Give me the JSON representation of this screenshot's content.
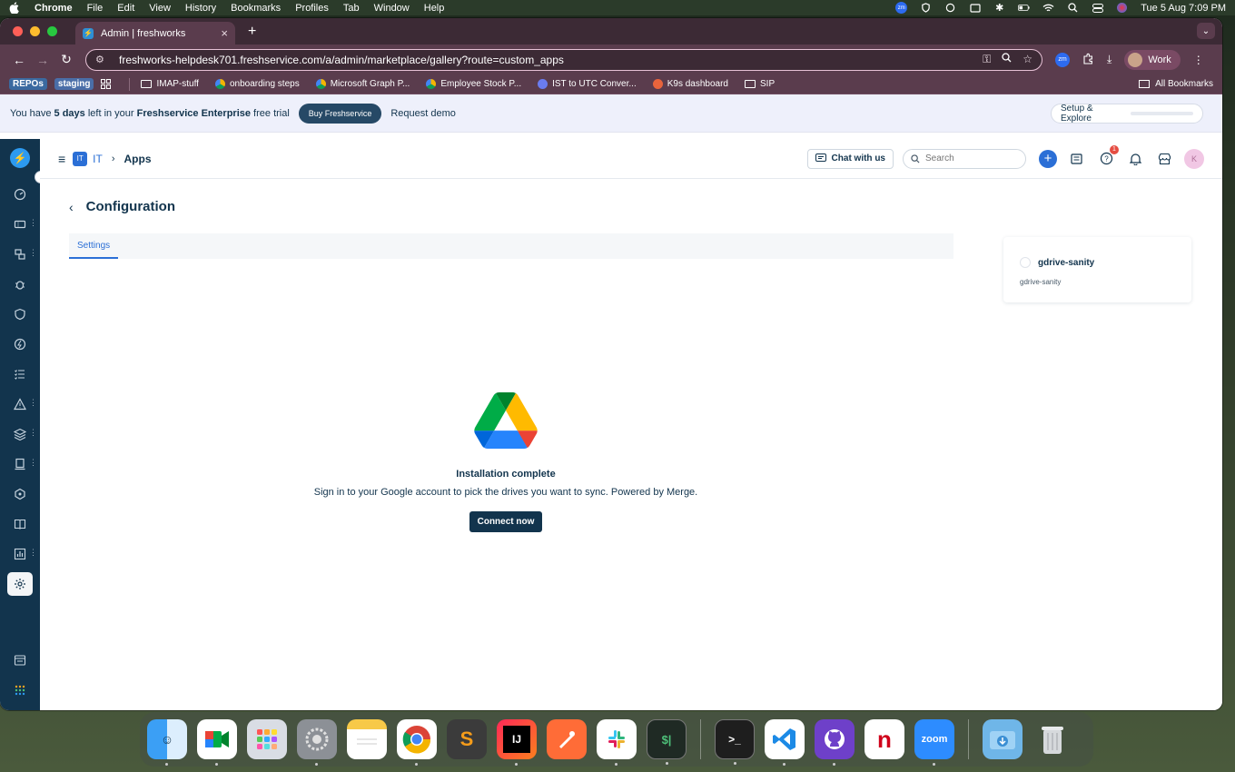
{
  "menubar": {
    "app": "Chrome",
    "items": [
      "File",
      "Edit",
      "View",
      "History",
      "Bookmarks",
      "Profiles",
      "Tab",
      "Window",
      "Help"
    ],
    "clock": "Tue 5 Aug  7:09 PM"
  },
  "browser": {
    "tab_title": "Admin | freshworks",
    "url": "freshworks-helpdesk701.freshservice.com/a/admin/marketplace/gallery?route=custom_apps",
    "profile": "Work",
    "bookmarks": {
      "chip1": "REPOs",
      "chip2": "staging",
      "items": [
        "IMAP-stuff",
        "onboarding steps",
        "Microsoft Graph P...",
        "Employee Stock P...",
        "IST to UTC Conver...",
        "K9s dashboard",
        "SIP"
      ],
      "all": "All Bookmarks"
    }
  },
  "trial": {
    "prefix": "You have ",
    "days": "5 days",
    "middle": " left in your ",
    "plan": "Freshservice Enterprise",
    "suffix": " free trial",
    "buy": "Buy Freshservice",
    "demo": "Request demo",
    "setup": "Setup & Explore"
  },
  "header": {
    "workspace_badge": "IT",
    "workspace": "IT",
    "breadcrumb": "Apps",
    "chat": "Chat with us",
    "search_placeholder": "Search",
    "notification_count": "1",
    "avatar": "K"
  },
  "page": {
    "title": "Configuration",
    "tab": "Settings"
  },
  "app_card": {
    "name": "gdrive-sanity",
    "subtitle": "gdrive-sanity"
  },
  "install": {
    "title": "Installation complete",
    "description": "Sign in to your Google account to pick the drives you want to sync. Powered by Merge.",
    "button": "Connect now"
  },
  "colors": {
    "nav_bg": "#12344d",
    "primary": "#2b6fd6",
    "dark_button": "#12344d"
  }
}
